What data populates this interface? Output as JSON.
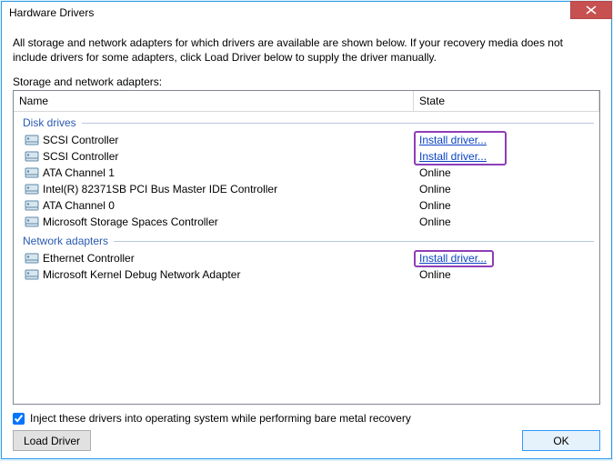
{
  "window": {
    "title": "Hardware Drivers"
  },
  "intro": "All storage and network adapters for which drivers are available are shown below. If your recovery media does not include drivers for some adapters, click Load Driver below to supply the driver manually.",
  "table": {
    "label": "Storage and network adapters:",
    "headers": {
      "name": "Name",
      "state": "State"
    },
    "groups": [
      {
        "label": "Disk drives",
        "rows": [
          {
            "name": "SCSI Controller",
            "state": "Install driver...",
            "link": true,
            "highlight": "boxstart"
          },
          {
            "name": "SCSI Controller",
            "state": "Install driver...",
            "link": true,
            "highlight": "boxend"
          },
          {
            "name": "ATA Channel 1",
            "state": "Online"
          },
          {
            "name": "Intel(R) 82371SB PCI Bus Master IDE Controller",
            "state": "Online"
          },
          {
            "name": "ATA Channel 0",
            "state": "Online"
          },
          {
            "name": "Microsoft Storage Spaces Controller",
            "state": "Online"
          }
        ]
      },
      {
        "label": "Network adapters",
        "rows": [
          {
            "name": "Ethernet Controller",
            "state": "Install driver...",
            "link": true,
            "highlight": "single"
          },
          {
            "name": "Microsoft Kernel Debug Network Adapter",
            "state": "Online"
          }
        ]
      }
    ]
  },
  "checkbox": {
    "label": "Inject these drivers into operating system while performing bare metal recovery",
    "checked": true
  },
  "buttons": {
    "load": "Load Driver",
    "ok": "OK"
  }
}
